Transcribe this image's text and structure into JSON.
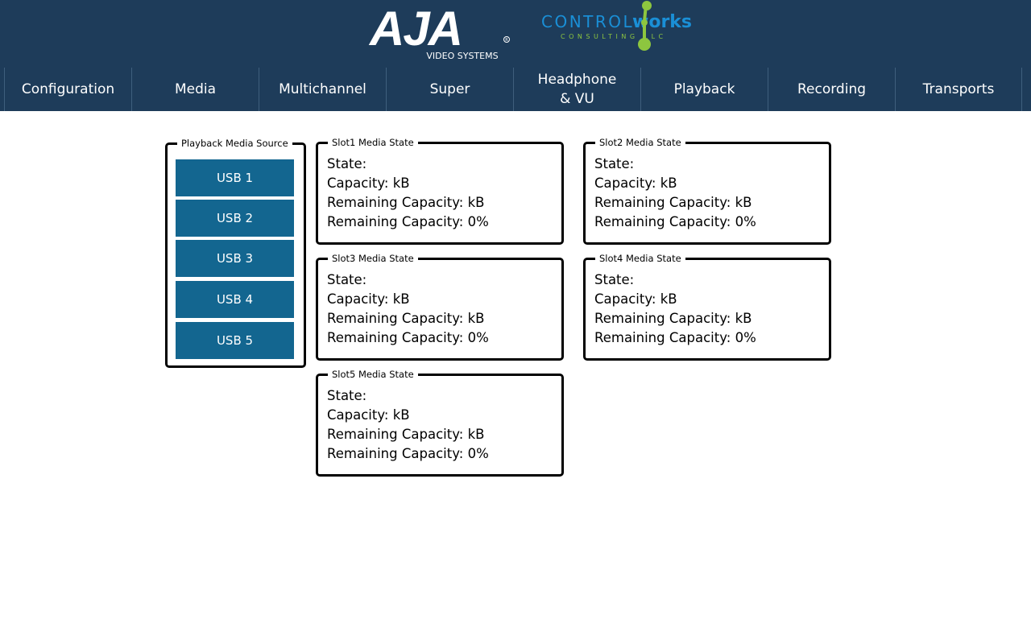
{
  "header": {
    "logo_aja_text": "AJA",
    "logo_aja_sub": "VIDEO SYSTEMS",
    "logo_cw_a": "CONTROL",
    "logo_cw_b": "works",
    "logo_cw_sub": "CONSULTING LLC"
  },
  "nav": {
    "tabs": [
      {
        "label": "Configuration"
      },
      {
        "label": "Media"
      },
      {
        "label": "Multichannel"
      },
      {
        "label": "Super"
      },
      {
        "label": "Headphone\n& VU"
      },
      {
        "label": "Playback"
      },
      {
        "label": "Recording"
      },
      {
        "label": "Transports"
      }
    ]
  },
  "source": {
    "legend": "Playback Media Source",
    "buttons": [
      {
        "label": "USB 1"
      },
      {
        "label": "USB 2"
      },
      {
        "label": "USB 3"
      },
      {
        "label": "USB 4"
      },
      {
        "label": "USB 5"
      }
    ]
  },
  "slots": [
    {
      "legend": "Slot1 Media State",
      "state": "State:",
      "capacity": "Capacity: kB",
      "remaining_kb": "Remaining Capacity: kB",
      "remaining_pct": "Remaining Capacity: 0%"
    },
    {
      "legend": "Slot2 Media State",
      "state": "State:",
      "capacity": "Capacity: kB",
      "remaining_kb": "Remaining Capacity: kB",
      "remaining_pct": "Remaining Capacity: 0%"
    },
    {
      "legend": "Slot3 Media State",
      "state": "State:",
      "capacity": "Capacity: kB",
      "remaining_kb": "Remaining Capacity: kB",
      "remaining_pct": "Remaining Capacity: 0%"
    },
    {
      "legend": "Slot4 Media State",
      "state": "State:",
      "capacity": "Capacity: kB",
      "remaining_kb": "Remaining Capacity: kB",
      "remaining_pct": "Remaining Capacity: 0%"
    },
    {
      "legend": "Slot5 Media State",
      "state": "State:",
      "capacity": "Capacity: kB",
      "remaining_kb": "Remaining Capacity: kB",
      "remaining_pct": "Remaining Capacity: 0%"
    }
  ],
  "colors": {
    "header_bg": "#1e3c5a",
    "button_bg": "#136690",
    "cw_green": "#8dc63f",
    "cw_blue": "#1a8fd6"
  }
}
